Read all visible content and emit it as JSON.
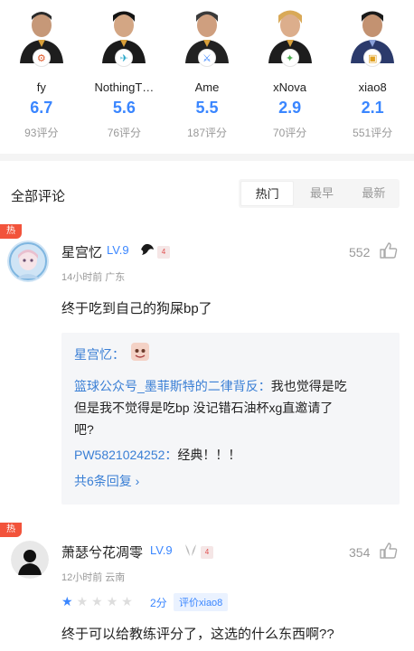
{
  "players": [
    {
      "name": "fy",
      "score": "6.7",
      "count": "93评分",
      "badge": "⚙",
      "badge_color": "#e05a2b"
    },
    {
      "name": "NothingT…",
      "score": "5.6",
      "count": "76评分",
      "badge": "✈",
      "badge_color": "#2ba8c9"
    },
    {
      "name": "Ame",
      "score": "5.5",
      "count": "187评分",
      "badge": "⚔",
      "badge_color": "#3a86ff"
    },
    {
      "name": "xNova",
      "score": "2.9",
      "count": "70评分",
      "badge": "✦",
      "badge_color": "#4caf50"
    },
    {
      "name": "xiao8",
      "score": "2.1",
      "count": "551评分",
      "badge": "▣",
      "badge_color": "#e0a020"
    }
  ],
  "comments_section": {
    "title": "全部评论",
    "sort_tabs": [
      {
        "label": "热门",
        "active": true
      },
      {
        "label": "最早",
        "active": false
      },
      {
        "label": "最新",
        "active": false
      }
    ]
  },
  "comment1": {
    "hot_label": "热",
    "username": "星宫忆",
    "level": "LV.9",
    "mini_badge": "4",
    "meta": "14小时前  广东",
    "likes": "552",
    "text": "终于吃到自己的狗屎bp了",
    "reply": {
      "author": "星宫忆：",
      "line1_link": "篮球公众号_墨菲斯特的二律背反：",
      "line1_text": "我也觉得是吃",
      "line2": "但是我不觉得是吃bp 没记错石油杯xg直邀请了",
      "line3": "吧?",
      "line4_link": "PW5821024252：",
      "line4_text": "经典！！！",
      "more": "共6条回复 ›"
    }
  },
  "comment2": {
    "hot_label": "热",
    "username": "萧瑟兮花凋零",
    "level": "LV.9",
    "mini_badge": "4",
    "meta": "12小时前  云南",
    "likes": "354",
    "rating_stars": 1,
    "rating_max": 5,
    "rating_score": "2分",
    "rating_tag": "评价xiao8",
    "text": "终于可以给教练评分了，这选的什么东西啊??"
  },
  "colors": {
    "accent": "#3a86ff",
    "hot": "#f2533b",
    "link": "#3a7fd5"
  }
}
